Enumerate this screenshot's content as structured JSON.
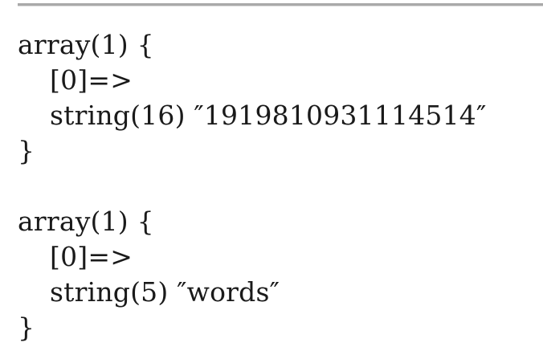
{
  "dumps": [
    {
      "header": "array(1) {",
      "key": "[0]=>",
      "value": "string(16) ″1919810931114514″",
      "footer": "}"
    },
    {
      "header": "array(1) {",
      "key": "[0]=>",
      "value": "string(5) ″words″",
      "footer": "}"
    }
  ]
}
